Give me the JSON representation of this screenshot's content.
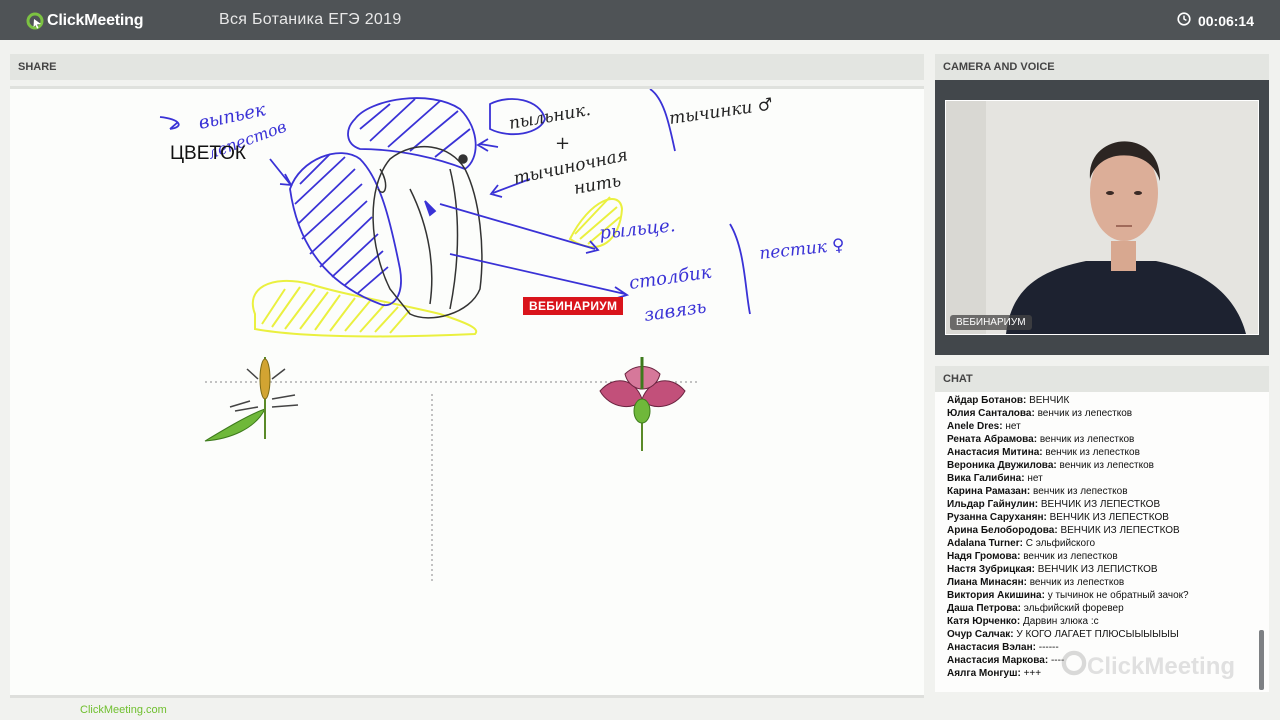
{
  "app": {
    "logo_text": "ClickMeeting",
    "meeting_title": "Вся Ботаника  ЕГЭ 2019",
    "timer": "00:06:14"
  },
  "share": {
    "header": "SHARE",
    "whiteboard_title": "ЦВЕТОК",
    "brand_tag": "ВЕБИНАРИУМ"
  },
  "camera": {
    "header": "CAMERA AND VOICE",
    "participant_label": "ВЕБИНАРИУМ"
  },
  "chat": {
    "header": "CHAT",
    "watermark": "ClickMeeting",
    "messages": [
      {
        "name": "Айдар Ботанов:",
        "text": "ВЕНЧИК"
      },
      {
        "name": "Юлия Санталова:",
        "text": "венчик из лепестков"
      },
      {
        "name": "Anele Dres:",
        "text": "нет"
      },
      {
        "name": "Рената Абрамова:",
        "text": "венчик из лепестков"
      },
      {
        "name": "Анастасия Митина:",
        "text": "венчик из лепестков"
      },
      {
        "name": "Вероника Двужилова:",
        "text": "венчик из лепестков"
      },
      {
        "name": "Вика Галибина:",
        "text": "нет"
      },
      {
        "name": "Карина Рамазан:",
        "text": "венчик из лепестков"
      },
      {
        "name": "Ильдар Гайнулин:",
        "text": "ВЕНЧИК ИЗ ЛЕПЕСТКОВ"
      },
      {
        "name": "Рузанна Саруханян:",
        "text": "ВЕНЧИК ИЗ ЛЕПЕСТКОВ"
      },
      {
        "name": "Арина Белобородова:",
        "text": "ВЕНЧИК ИЗ ЛЕПЕСТКОВ"
      },
      {
        "name": "Adalana Turner:",
        "text": "С эльфийского"
      },
      {
        "name": "Надя Громова:",
        "text": "венчик из лепестков"
      },
      {
        "name": "Настя Зубрицкая:",
        "text": "ВЕНЧИК ИЗ ЛЕПИСТКОВ"
      },
      {
        "name": "Лиана Минасян:",
        "text": "венчик из лепестков"
      },
      {
        "name": "Виктория Акишина:",
        "text": "у тычинок не обратный зачок?"
      },
      {
        "name": "Даша Петрова:",
        "text": "эльфийский форевер"
      },
      {
        "name": "Катя Юрченко:",
        "text": "Дарвин злюка :с"
      },
      {
        "name": "Очур Салчак:",
        "text": "У КОГО ЛАГАЕТ ПЛЮСЫЫЫЫЫЫ"
      },
      {
        "name": "Анастасия Вэлан:",
        "text": "------"
      },
      {
        "name": "Анастасия Маркова:",
        "text": "----"
      },
      {
        "name": "Аялга Монгуш:",
        "text": "+++"
      }
    ]
  },
  "footer": {
    "link": "ClickMeeting.com"
  },
  "colors": {
    "topbar": "#4f5356",
    "accent_green": "#6fbf2e",
    "brand_red": "#d9141b",
    "pen_blue": "#3a32d6",
    "pen_yellow": "#e9ef2b"
  },
  "icons": [
    "clickmeeting-logo-icon",
    "clock-icon"
  ]
}
